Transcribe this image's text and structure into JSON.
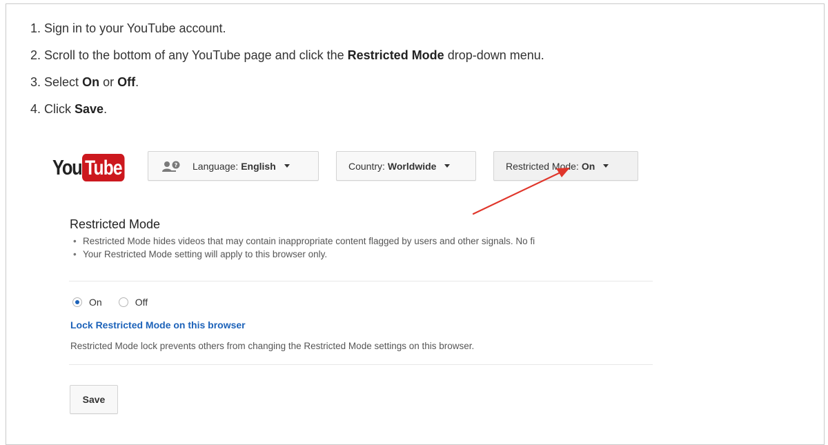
{
  "steps": [
    {
      "num": "1.",
      "pre": "Sign in to your YouTube account.",
      "bold": "",
      "post": ""
    },
    {
      "num": "2.",
      "pre": "Scroll to the bottom of any YouTube page and click the ",
      "bold": "Restricted Mode",
      "post": " drop-down menu."
    },
    {
      "num": "3.",
      "pre": "Select ",
      "bold": "On",
      "mid": " or ",
      "bold2": "Off",
      "post": "."
    },
    {
      "num": "4.",
      "pre": "Click ",
      "bold": "Save",
      "post": "."
    }
  ],
  "logo": {
    "you": "You",
    "tube": "Tube"
  },
  "footer_buttons": {
    "language_prefix": "Language: ",
    "language_value": "English",
    "country_prefix": "Country: ",
    "country_value": "Worldwide",
    "restricted_prefix": "Restricted Mode: ",
    "restricted_value": "On"
  },
  "panel": {
    "title": "Restricted Mode",
    "bullets": [
      "Restricted Mode hides videos that may contain inappropriate content flagged by users and other signals. No fi",
      "Your Restricted Mode setting will apply to this browser only."
    ],
    "bullet_glyph": "•",
    "options": [
      {
        "label": "On",
        "checked": true
      },
      {
        "label": "Off",
        "checked": false
      }
    ],
    "lock_link": "Lock Restricted Mode on this browser",
    "lock_desc": "Restricted Mode lock prevents others from changing the Restricted Mode settings on this browser.",
    "save_label": "Save"
  },
  "colors": {
    "brand_red": "#cc181e",
    "link_blue": "#1c62b9",
    "arrow_red": "#e0362b"
  },
  "icons": [
    "language-person-icon",
    "caret-down-icon",
    "annotation-arrow"
  ]
}
